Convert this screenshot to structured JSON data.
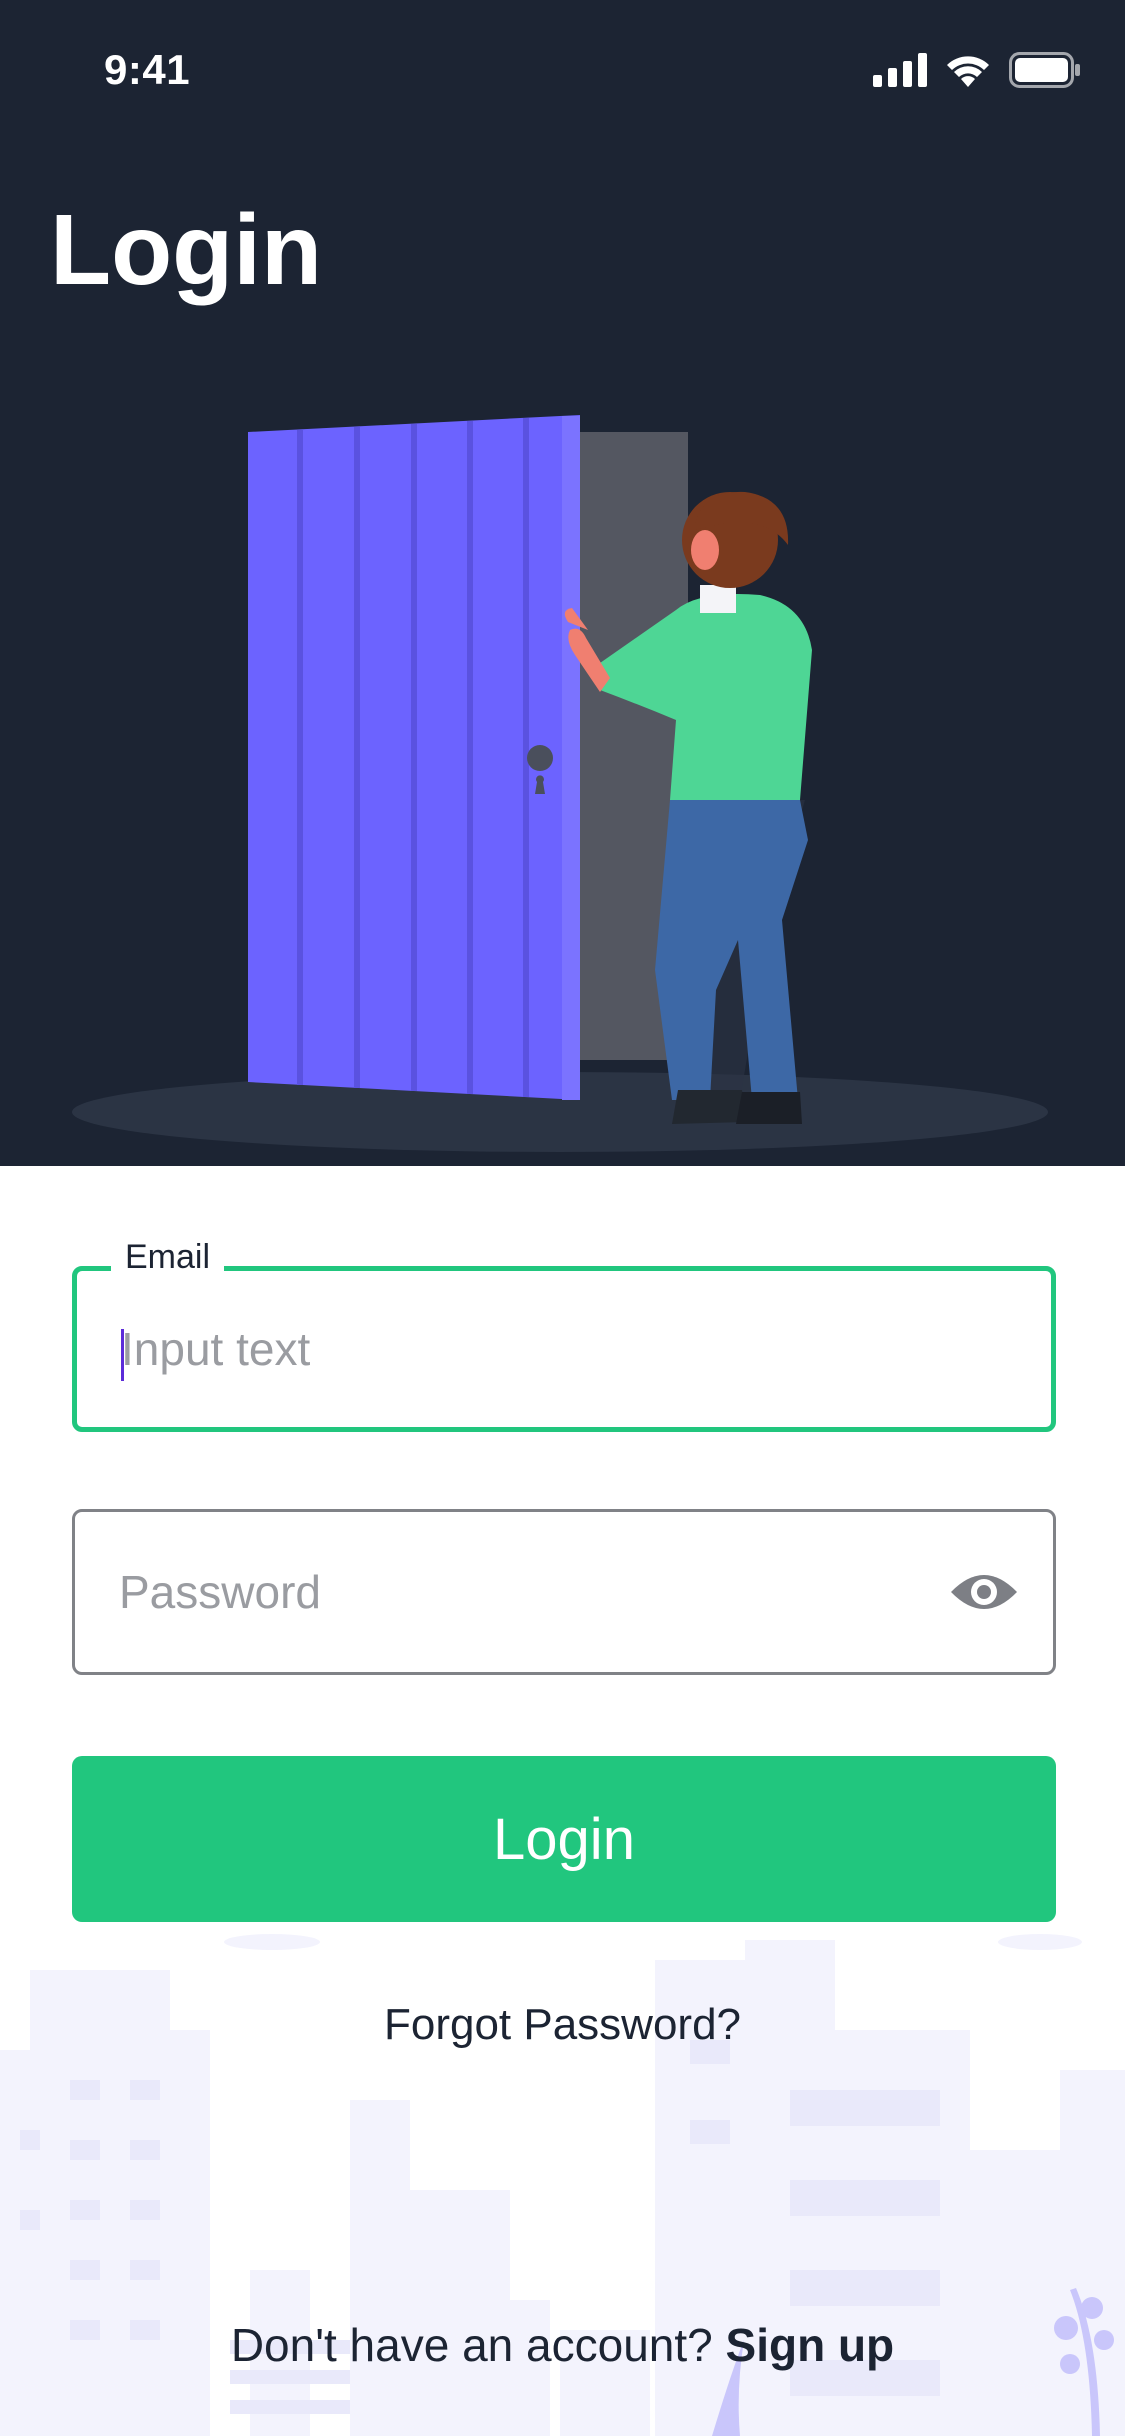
{
  "status_bar": {
    "time": "9:41"
  },
  "header": {
    "title": "Login"
  },
  "form": {
    "email": {
      "label": "Email",
      "placeholder": "Input text",
      "value": ""
    },
    "password": {
      "placeholder": "Password",
      "value": ""
    },
    "login_label": "Login",
    "forgot_label": "Forgot Password?"
  },
  "footer": {
    "prompt": "Don't have an account?",
    "signup_label": "Sign up"
  },
  "colors": {
    "hero_background": "#1c2433",
    "accent": "#21c67e",
    "door": "#6c63ff",
    "text": "#1c2433"
  }
}
